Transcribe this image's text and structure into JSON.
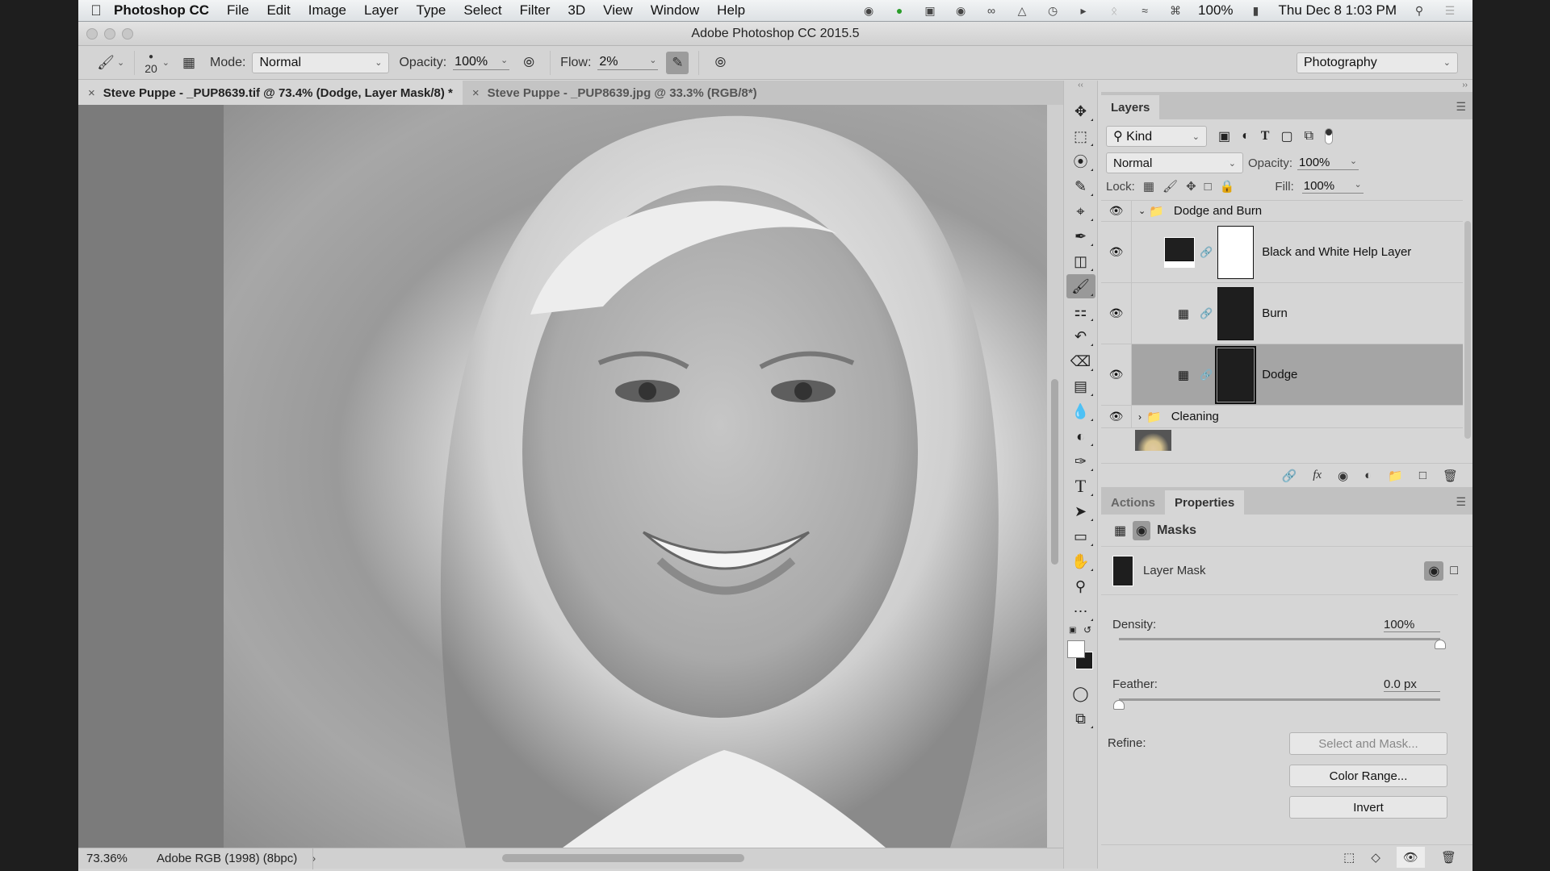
{
  "menubar": {
    "app_name": "Photoshop CC",
    "items": [
      "File",
      "Edit",
      "Image",
      "Layer",
      "Type",
      "Select",
      "Filter",
      "3D",
      "View",
      "Window",
      "Help"
    ],
    "battery": "100%",
    "datetime": "Thu Dec 8  1:03 PM"
  },
  "window": {
    "title": "Adobe Photoshop CC 2015.5"
  },
  "options": {
    "brush_size": "20",
    "mode_label": "Mode:",
    "mode_value": "Normal",
    "opacity_label": "Opacity:",
    "opacity_value": "100%",
    "flow_label": "Flow:",
    "flow_value": "2%",
    "workspace": "Photography"
  },
  "tabs": [
    {
      "label": "Steve Puppe - _PUP8639.tif @ 73.4% (Dodge, Layer Mask/8) *",
      "active": true
    },
    {
      "label": "Steve Puppe - _PUP8639.jpg @ 33.3% (RGB/8*)",
      "active": false
    }
  ],
  "status": {
    "zoom": "73.36%",
    "profile": "Adobe RGB (1998) (8bpc)"
  },
  "layers_panel": {
    "tab": "Layers",
    "filter_kind": "Kind",
    "blend_mode": "Normal",
    "opacity_label": "Opacity:",
    "opacity_value": "100%",
    "lock_label": "Lock:",
    "fill_label": "Fill:",
    "fill_value": "100%",
    "layers": [
      {
        "name": "Dodge and Burn",
        "type": "group",
        "expanded": true
      },
      {
        "name": "Black and White Help Layer",
        "type": "adjustment-bw"
      },
      {
        "name": "Burn",
        "type": "adjustment-curves"
      },
      {
        "name": "Dodge",
        "type": "adjustment-curves",
        "selected": true
      },
      {
        "name": "Cleaning",
        "type": "group",
        "expanded": false
      }
    ]
  },
  "properties_panel": {
    "tabs": [
      "Actions",
      "Properties"
    ],
    "active_tab": "Properties",
    "section": "Masks",
    "mask_label": "Layer Mask",
    "density_label": "Density:",
    "density_value": "100%",
    "density_fraction": 1.0,
    "feather_label": "Feather:",
    "feather_value": "0.0 px",
    "feather_fraction": 0.0,
    "refine_label": "Refine:",
    "buttons": {
      "select_and_mask": "Select and Mask...",
      "color_range": "Color Range...",
      "invert": "Invert"
    }
  }
}
